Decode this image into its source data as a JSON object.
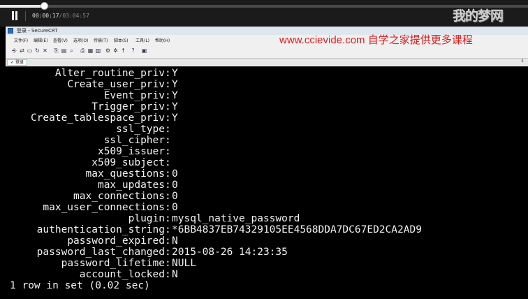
{
  "player": {
    "current_time": "00:00:17",
    "total_time": "/03:04:57",
    "progress_fraction": 0.085
  },
  "watermark": "我的梦网",
  "window": {
    "title": "登录 - SecureCRT",
    "menu": [
      "文件(F)",
      "编辑(E)",
      "查看(V)",
      "选项(O)",
      "传输(T)",
      "脚本(S)",
      "工具(L)",
      "帮助(H)"
    ],
    "tab_label": "登录",
    "tab_end": "4"
  },
  "banner": "www.ccievide.com  自学之家提供更多课程",
  "terminal": {
    "rows": [
      {
        "field": "Alter_routine_priv",
        "value": "Y"
      },
      {
        "field": "Create_user_priv",
        "value": "Y"
      },
      {
        "field": "Event_priv",
        "value": "Y"
      },
      {
        "field": "Trigger_priv",
        "value": "Y"
      },
      {
        "field": "Create_tablespace_priv",
        "value": "Y"
      },
      {
        "field": "ssl_type",
        "value": ""
      },
      {
        "field": "ssl_cipher",
        "value": ""
      },
      {
        "field": "x509_issuer",
        "value": ""
      },
      {
        "field": "x509_subject",
        "value": ""
      },
      {
        "field": "max_questions",
        "value": "0"
      },
      {
        "field": "max_updates",
        "value": "0"
      },
      {
        "field": "max_connections",
        "value": "0"
      },
      {
        "field": "max_user_connections",
        "value": "0"
      },
      {
        "field": "plugin",
        "value": "mysql_native_password"
      },
      {
        "field": "authentication_string",
        "value": "*6BB4837EB74329105EE4568DDA7DC67ED2CA2AD9"
      },
      {
        "field": "password_expired",
        "value": "N"
      },
      {
        "field": "password_last_changed",
        "value": "2015-08-26 14:23:35"
      },
      {
        "field": "password_lifetime",
        "value": "NULL"
      },
      {
        "field": "account_locked",
        "value": "N"
      }
    ],
    "footer": "1 row in set (0.02 sec)"
  }
}
